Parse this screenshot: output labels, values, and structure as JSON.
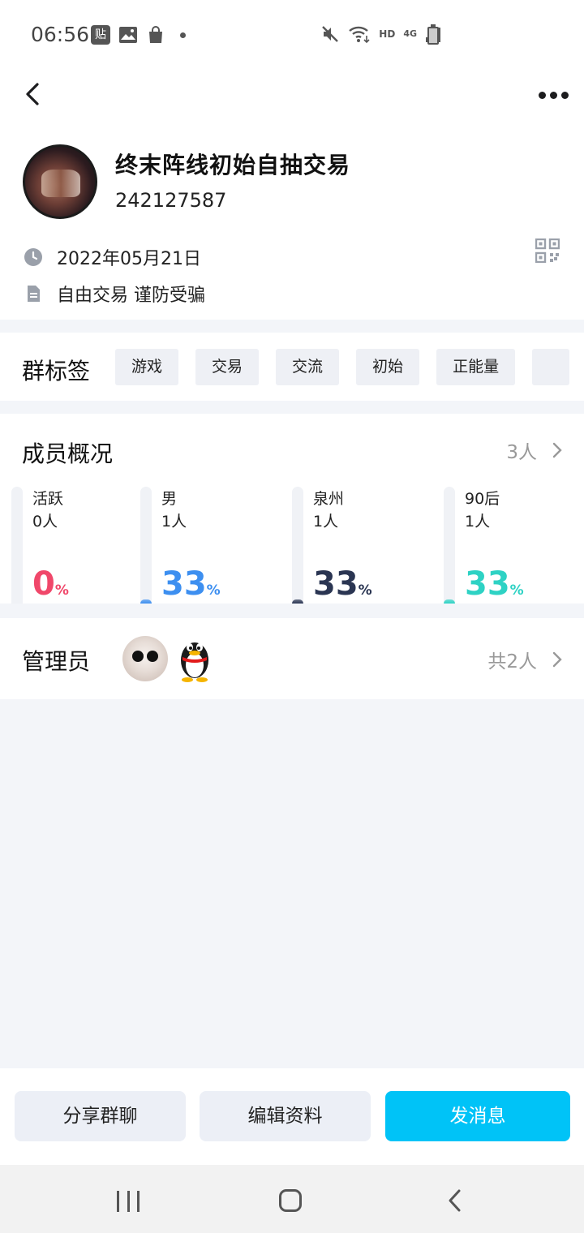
{
  "status_bar": {
    "time": "06:56",
    "notif_badge": "贴",
    "network_hd": "HD",
    "network_4g": "4G"
  },
  "group": {
    "name": "终末阵线初始自抽交易",
    "id": "242127587",
    "created_date": "2022年05月21日",
    "description": "自由交易 谨防受骗"
  },
  "tags_section": {
    "title": "群标签",
    "tags": [
      "游戏",
      "交易",
      "交流",
      "初始",
      "正能量",
      ""
    ]
  },
  "members": {
    "title": "成员概况",
    "count": "3人",
    "stats": [
      {
        "label": "活跃",
        "value": "0人",
        "percent": "0",
        "unit": "%",
        "fill_percent": 0,
        "color": "#f0476a"
      },
      {
        "label": "男",
        "value": "1人",
        "percent": "33",
        "unit": "%",
        "fill_percent": 33,
        "color": "#3d8ff0"
      },
      {
        "label": "泉州",
        "value": "1人",
        "percent": "33",
        "unit": "%",
        "fill_percent": 33,
        "color": "#2a3552"
      },
      {
        "label": "90后",
        "value": "1人",
        "percent": "33",
        "unit": "%",
        "fill_percent": 33,
        "color": "#2ed2c4"
      }
    ]
  },
  "admins": {
    "title": "管理员",
    "count": "共2人"
  },
  "actions": {
    "share": "分享群聊",
    "edit": "编辑资料",
    "send": "发消息"
  },
  "colors": {
    "primary": "#00c3f7",
    "page_bg": "#f3f5f9"
  }
}
